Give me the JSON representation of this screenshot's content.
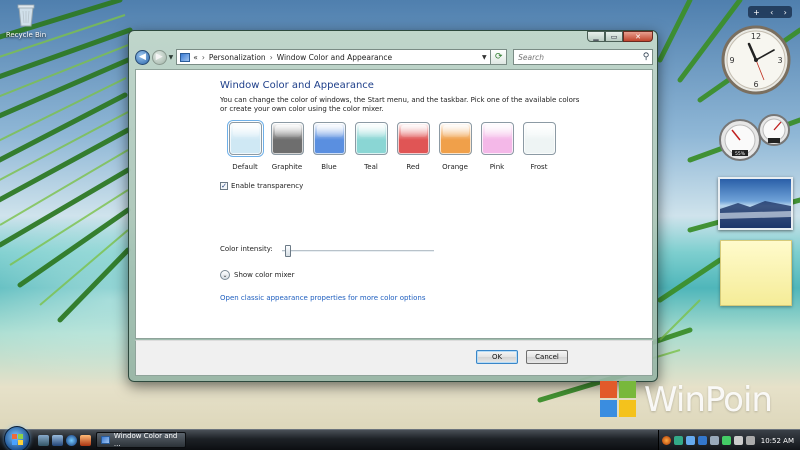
{
  "desktop": {
    "recycle_bin_label": "Recycle Bin"
  },
  "window": {
    "breadcrumb": {
      "prefix": "«",
      "items": [
        "Personalization",
        "Window Color and Appearance"
      ]
    },
    "search_placeholder": "Search",
    "heading": "Window Color and Appearance",
    "description": "You can change the color of windows, the Start menu, and the taskbar. Pick one of the available colors or create your own color using the color mixer.",
    "swatches": [
      {
        "label": "Default",
        "color": "#cfe8f4"
      },
      {
        "label": "Graphite",
        "color": "#6e6e6e"
      },
      {
        "label": "Blue",
        "color": "#5a8fe0"
      },
      {
        "label": "Teal",
        "color": "#8ad6d4"
      },
      {
        "label": "Red",
        "color": "#e05555"
      },
      {
        "label": "Orange",
        "color": "#f0a04a"
      },
      {
        "label": "Pink",
        "color": "#f4b8e8"
      },
      {
        "label": "Frost",
        "color": "#eef4f4"
      }
    ],
    "selected_swatch": "Default",
    "transparency": {
      "label": "Enable transparency",
      "checked": true
    },
    "intensity": {
      "label": "Color intensity:",
      "value": 0.02
    },
    "mixer_label": "Show color mixer",
    "classic_link": "Open classic appearance properties for more color options",
    "ok_label": "OK",
    "cancel_label": "Cancel"
  },
  "taskbar": {
    "task_button": "Window Color and ...",
    "time": "10:52 AM"
  },
  "watermark": "WinPoin",
  "colors": {
    "accent": "#1e3f8a",
    "link": "#1f5fbf"
  }
}
